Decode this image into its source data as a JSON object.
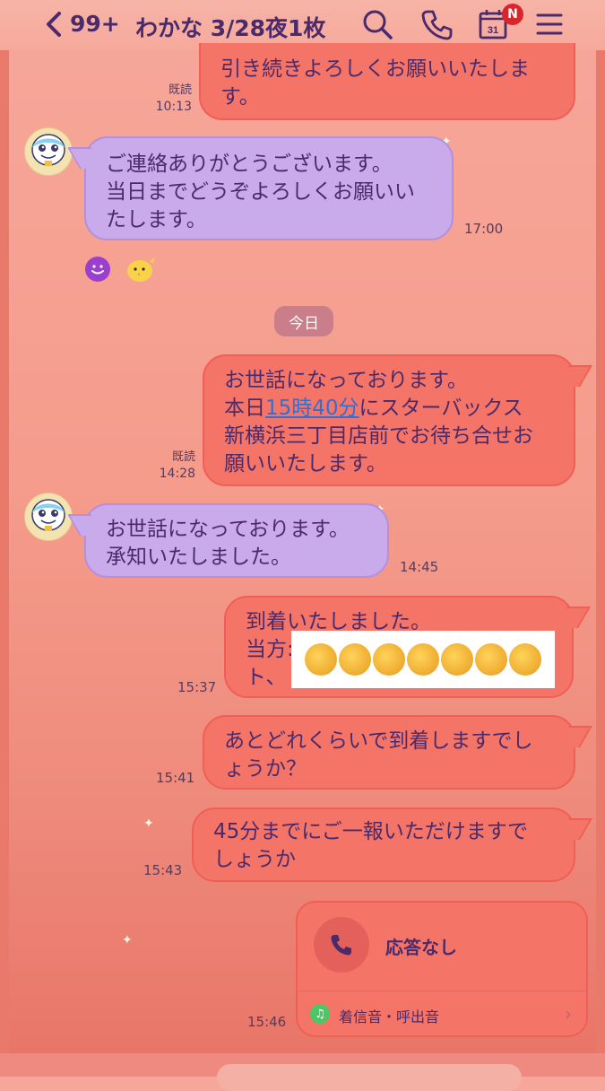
{
  "header": {
    "unread_count": "99+",
    "title": "わかな 3/28夜1枚",
    "calendar_day": "31",
    "calendar_badge": "N"
  },
  "messages": [
    {
      "id": "m1",
      "dir": "out",
      "text": "引き続きよろしくお願いいたしま\nす。",
      "read": "既読",
      "time": "10:13"
    },
    {
      "id": "m2",
      "dir": "in",
      "text": "ご連絡ありがとうございます。\n当日までどうぞよろしくお願いい\nたします。",
      "time": "17:00"
    },
    {
      "id": "m3",
      "dir": "out",
      "text_pre": "お世話になっております。\n本日",
      "link": "15時40分",
      "text_post": "にスターバックス\n新横浜三丁目店前でお待ち合せお\n願いいたします。",
      "read": "既読",
      "time": "14:28"
    },
    {
      "id": "m4",
      "dir": "in",
      "text": "お世話になっております。\n承知いたしました。",
      "time": "14:45"
    },
    {
      "id": "m5",
      "dir": "out",
      "line1": "到着いたしました。",
      "line2": "当方:",
      "line3": "ト、",
      "time": "15:37"
    },
    {
      "id": "m6",
      "dir": "out",
      "text": "あとどれくらいで到着しますでし\nょうか？",
      "time": "15:41"
    },
    {
      "id": "m7",
      "dir": "out",
      "text": "45分までにご一報いただけますで\nしょうか",
      "time": "15:43"
    }
  ],
  "date_separator": "今日",
  "call": {
    "status": "応答なし",
    "ringtone_label": "着信音・呼出音",
    "time": "15:46"
  },
  "colors": {
    "outgoing_bubble": "#f57468",
    "incoming_bubble": "#c9aaea",
    "text": "#4a2a6a",
    "link": "#2f6fd6"
  },
  "icons": [
    "chevron-left-icon",
    "search-icon",
    "phone-icon",
    "calendar-icon",
    "menu-icon",
    "smiley-icon",
    "chick-sticker-icon",
    "music-note-icon"
  ]
}
